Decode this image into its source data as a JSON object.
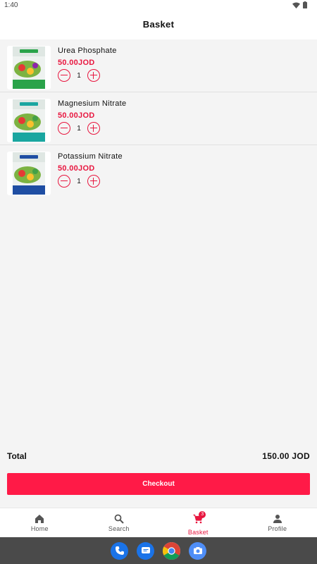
{
  "status_bar": {
    "time": "1:40"
  },
  "header": {
    "title": "Basket"
  },
  "items": [
    {
      "name": "Urea Phosphate",
      "price": "50.00JOD",
      "quantity": "1",
      "image_icon": "fertilizer-bag-icon",
      "bag_color": "#2aa34a"
    },
    {
      "name": "Magnesium Nitrate",
      "price": "50.00JOD",
      "quantity": "1",
      "image_icon": "fertilizer-bag-icon",
      "bag_color": "#1aa6a0"
    },
    {
      "name": "Potassium Nitrate",
      "price": "50.00JOD",
      "quantity": "1",
      "image_icon": "fertilizer-bag-icon",
      "bag_color": "#1f4ea3"
    }
  ],
  "summary": {
    "total_label": "Total",
    "total_value": "150.00 JOD"
  },
  "checkout": {
    "label": "Checkout"
  },
  "bottom_nav": {
    "items": [
      {
        "label": "Home",
        "icon": "home-icon"
      },
      {
        "label": "Search",
        "icon": "search-icon"
      },
      {
        "label": "Basket",
        "icon": "cart-icon",
        "badge": "3",
        "active": true
      },
      {
        "label": "Profile",
        "icon": "person-icon"
      }
    ]
  },
  "dock": {
    "apps": [
      "phone-icon",
      "messages-icon",
      "chrome-icon",
      "camera-icon"
    ]
  },
  "colors": {
    "accent": "#e8163f",
    "checkout_bg": "#ff1a47",
    "background": "#f4f4f4",
    "system_nav": "#4a4a4a"
  }
}
